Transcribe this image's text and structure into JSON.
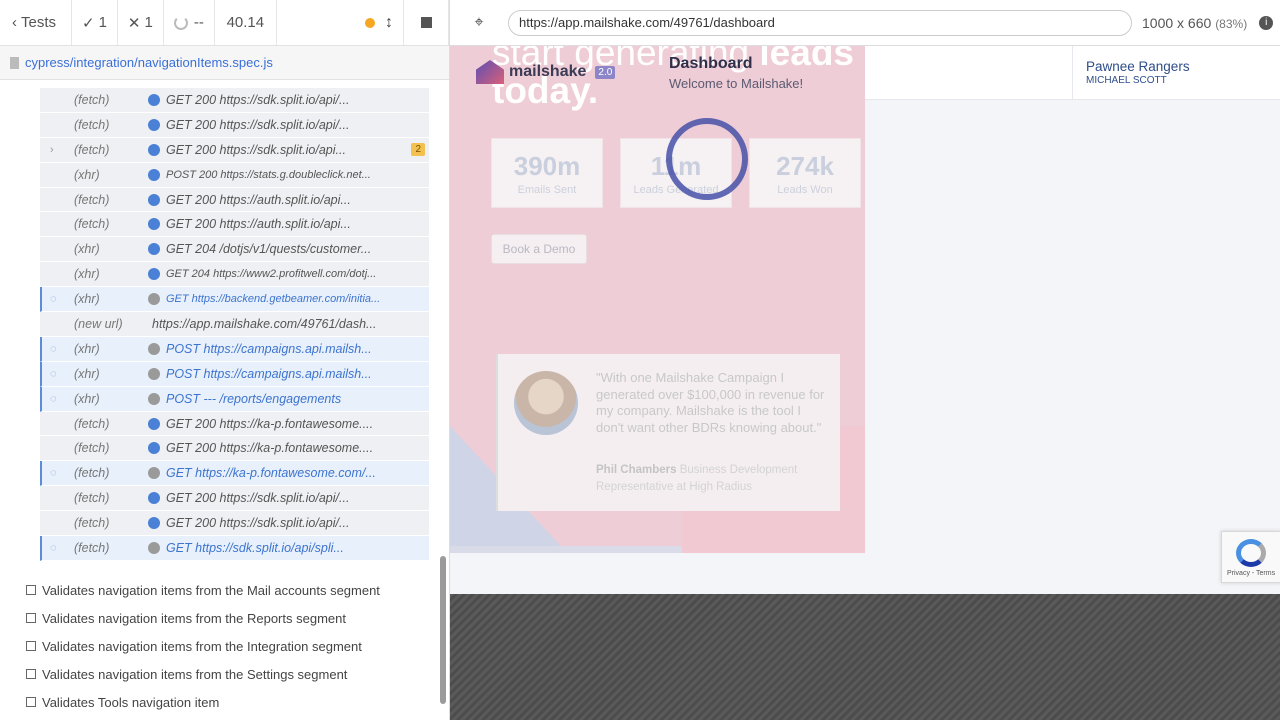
{
  "reporter": {
    "tests_label": "Tests",
    "passed": "1",
    "failed": "1",
    "pending": "--",
    "duration": "40.14",
    "spec_path": "cypress/integration/navigationItems.spec.js"
  },
  "commands": [
    {
      "name": "(fetch)",
      "msg": "GET 200 https://sdk.split.io/api/...",
      "state": "done"
    },
    {
      "name": "(fetch)",
      "msg": "GET 200 https://sdk.split.io/api/...",
      "state": "done"
    },
    {
      "name": "(fetch)",
      "msg": "GET 200 https://sdk.split.io/api...",
      "state": "done",
      "badge": "2",
      "caret": true
    },
    {
      "name": "(xhr)",
      "msg": "POST 200 https://stats.g.doubleclick.net...",
      "state": "done",
      "small": true
    },
    {
      "name": "(fetch)",
      "msg": "GET 200 https://auth.split.io/api...",
      "state": "done"
    },
    {
      "name": "(fetch)",
      "msg": "GET 200 https://auth.split.io/api...",
      "state": "done"
    },
    {
      "name": "(xhr)",
      "msg": "GET 204 /dotjs/v1/quests/customer...",
      "state": "done"
    },
    {
      "name": "(xhr)",
      "msg": "GET 204 https://www2.profitwell.com/dotj...",
      "state": "done",
      "small": true
    },
    {
      "name": "(xhr)",
      "msg": "GET https://backend.getbeamer.com/initia...",
      "state": "pending",
      "small": true
    },
    {
      "name": "(new url)",
      "msg": "https://app.mailshake.com/49761/dash...",
      "state": "url"
    },
    {
      "name": "(xhr)",
      "msg": "POST https://campaigns.api.mailsh...",
      "state": "pending"
    },
    {
      "name": "(xhr)",
      "msg": "POST https://campaigns.api.mailsh...",
      "state": "pending"
    },
    {
      "name": "(xhr)",
      "msg": "POST --- /reports/engagements",
      "state": "pending"
    },
    {
      "name": "(fetch)",
      "msg": "GET 200 https://ka-p.fontawesome....",
      "state": "done"
    },
    {
      "name": "(fetch)",
      "msg": "GET 200 https://ka-p.fontawesome....",
      "state": "done"
    },
    {
      "name": "(fetch)",
      "msg": "GET https://ka-p.fontawesome.com/...",
      "state": "pending"
    },
    {
      "name": "(fetch)",
      "msg": "GET 200 https://sdk.split.io/api/...",
      "state": "done"
    },
    {
      "name": "(fetch)",
      "msg": "GET 200 https://sdk.split.io/api/...",
      "state": "done"
    },
    {
      "name": "(fetch)",
      "msg": "GET https://sdk.split.io/api/spli...",
      "state": "pending"
    }
  ],
  "tests": [
    "Validates navigation items from the Mail accounts segment",
    "Validates navigation items from the Reports segment",
    "Validates navigation items from the Integration segment",
    "Validates navigation items from the Settings segment",
    "Validates Tools navigation item"
  ],
  "runner": {
    "url": "https://app.mailshake.com/49761/dashboard",
    "viewport": "1000 x 660",
    "scale": "(83%)"
  },
  "app": {
    "logo_text": "mailshake",
    "logo_version": "2.0",
    "page_title": "Dashboard",
    "page_subtitle": "Welcome to Mailshake!",
    "account_name": "Pawnee Rangers",
    "account_user": "MICHAEL SCOTT",
    "hero_line1": "start generating",
    "hero_line1_bold": "leads",
    "hero_line2": "today.",
    "stats": [
      {
        "value": "390m",
        "label": "Emails Sent"
      },
      {
        "value": "11m",
        "label": "Leads Generated"
      },
      {
        "value": "274k",
        "label": "Leads Won"
      }
    ],
    "demo_button": "Book a Demo",
    "quote": "\"With one Mailshake Campaign I generated over $100,000 in revenue for my company. Mailshake is the tool I don't want other BDRs knowing about.\"",
    "quote_author": "Phil Chambers",
    "quote_role": "Business Development Representative at High Radius",
    "recaptcha_text": "Privacy - Terms"
  },
  "colors": {
    "pass": "#22a06b",
    "fail": "#e24a3b",
    "pending_highlight": "#e8f0fb",
    "brand": "#4651a8"
  }
}
